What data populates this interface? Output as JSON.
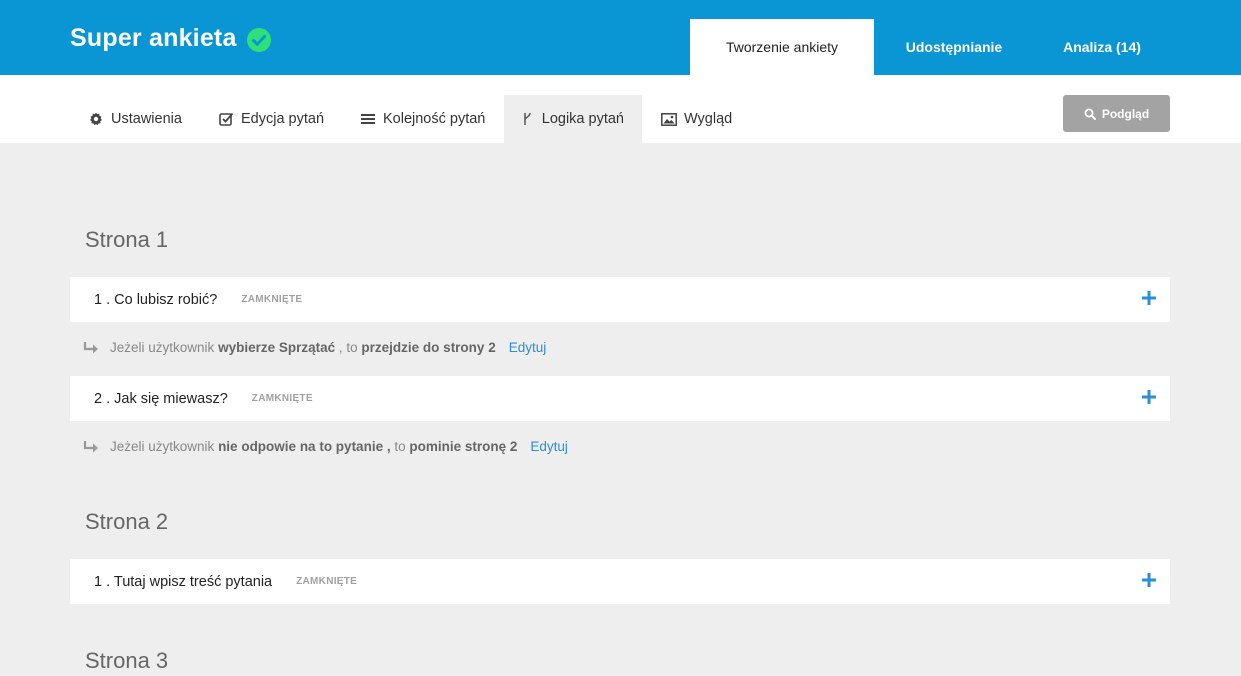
{
  "header": {
    "title": "Super ankieta",
    "tabs": [
      {
        "label": "Tworzenie ankiety",
        "active": true
      },
      {
        "label": "Udostępnianie",
        "active": false
      },
      {
        "label": "Analiza (14)",
        "active": false
      }
    ]
  },
  "subnav": {
    "items": [
      {
        "label": "Ustawienia",
        "icon": "gear-icon"
      },
      {
        "label": "Edycja pytań",
        "icon": "checkbox-icon"
      },
      {
        "label": "Kolejność pytań",
        "icon": "list-icon"
      },
      {
        "label": "Logika pytań",
        "icon": "branch-icon",
        "active": true
      },
      {
        "label": "Wygląd",
        "icon": "image-icon"
      }
    ],
    "preview_label": "Podgląd"
  },
  "pages": [
    {
      "heading": "Strona 1",
      "questions": [
        {
          "text": "1 . Co lubisz robić?",
          "badge": "ZAMKNIĘTE",
          "logic": {
            "prefix": "Jeżeli użytkownik",
            "condition": "wybierze Sprzątać",
            "middle": ", to",
            "action": "przejdzie do strony 2",
            "edit": "Edytuj"
          }
        },
        {
          "text": "2 . Jak się miewasz?",
          "badge": "ZAMKNIĘTE",
          "logic": {
            "prefix": "Jeżeli użytkownik",
            "condition": "nie odpowie na to pytanie ,",
            "middle": "to",
            "action": "pominie stronę 2",
            "edit": "Edytuj"
          }
        }
      ]
    },
    {
      "heading": "Strona 2",
      "questions": [
        {
          "text": "1 . Tutaj wpisz treść pytania",
          "badge": "ZAMKNIĘTE"
        }
      ]
    },
    {
      "heading": "Strona 3",
      "questions": []
    }
  ],
  "colors": {
    "brand": "#0a96d4",
    "check": "#2ee07a",
    "link": "#2a8fd6",
    "preview_button": "#a3a3a3"
  }
}
